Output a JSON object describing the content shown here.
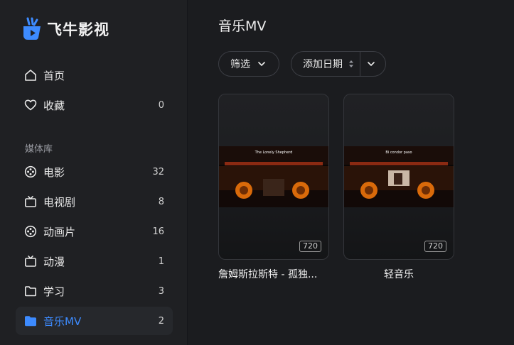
{
  "app": {
    "name": "飞牛影视"
  },
  "sidebar": {
    "items_top": [
      {
        "label": "首页",
        "icon": "home-icon"
      },
      {
        "label": "收藏",
        "icon": "heart-icon",
        "count": "0"
      }
    ],
    "section_title": "媒体库",
    "libraries": [
      {
        "label": "电影",
        "icon": "film-reel-icon",
        "count": "32"
      },
      {
        "label": "电视剧",
        "icon": "tv-icon",
        "count": "8"
      },
      {
        "label": "动画片",
        "icon": "film-reel-icon",
        "count": "16"
      },
      {
        "label": "动漫",
        "icon": "tv-icon",
        "count": "1"
      },
      {
        "label": "学习",
        "icon": "folder-icon",
        "count": "3"
      },
      {
        "label": "音乐MV",
        "icon": "folder-icon",
        "count": "2",
        "active": true
      }
    ]
  },
  "main": {
    "title": "音乐MV",
    "toolbar": {
      "filter_label": "筛选",
      "sort_label": "添加日期"
    },
    "cards": [
      {
        "title": "詹姆斯拉斯特 - 孤独...",
        "resolution": "720",
        "poster_title": "The Lonely Shepherd"
      },
      {
        "title": "轻音乐",
        "resolution": "720",
        "poster_title": "Bi condor paso"
      }
    ]
  },
  "colors": {
    "accent": "#3d8bff",
    "background": "#1b1c1f",
    "sidebar": "#1f2023"
  }
}
